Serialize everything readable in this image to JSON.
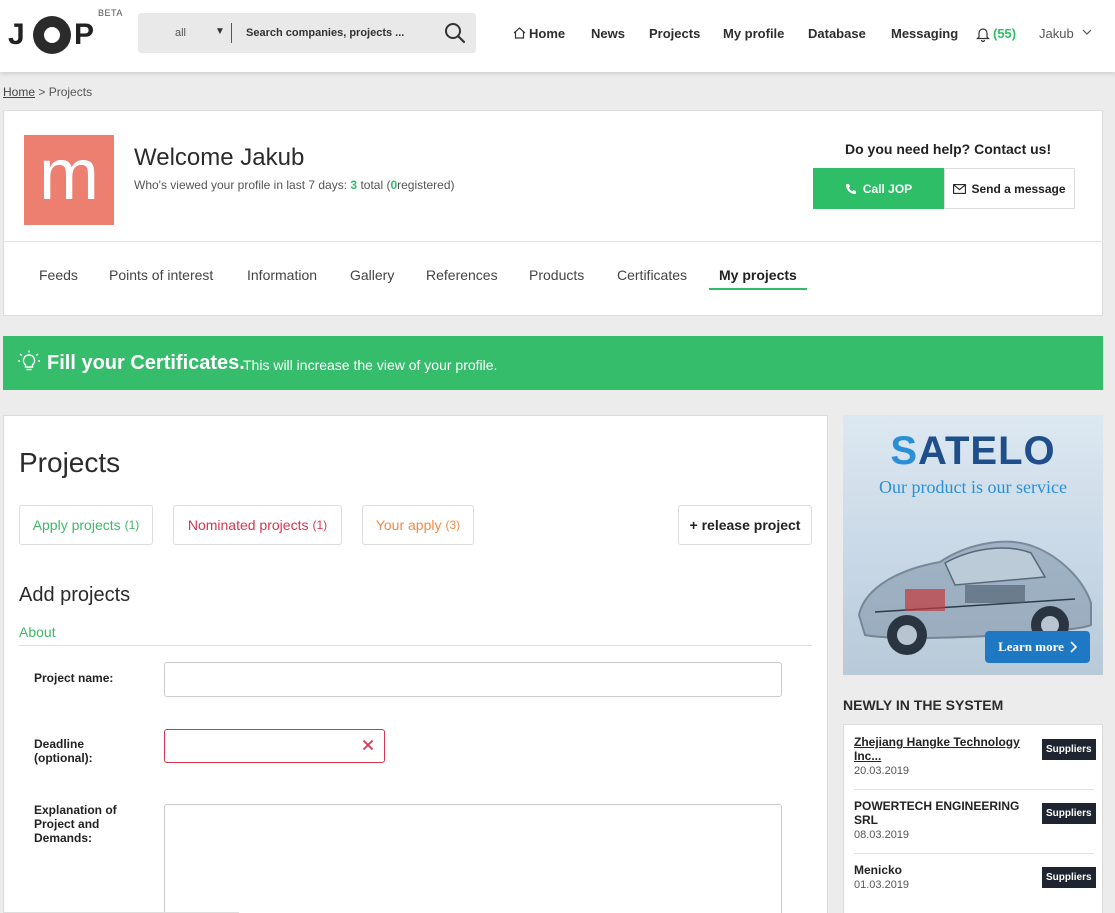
{
  "app": {
    "logo_text": "JOP",
    "beta_label": "BETA"
  },
  "search": {
    "scope_value": "all",
    "placeholder": "Search companies, projects ..."
  },
  "nav": {
    "home": "Home",
    "news": "News",
    "projects": "Projects",
    "my_profile": "My profile",
    "database": "Database",
    "messaging": "Messaging",
    "notifications_count": "(55)",
    "user_name": "Jakub"
  },
  "breadcrumb": {
    "home": "Home",
    "separator": ">",
    "current": "Projects"
  },
  "profile": {
    "avatar_letter": "m",
    "avatar_color": "#ec7f6f",
    "welcome": "Welcome Jakub",
    "viewed_prefix": "Who's viewed your profile in last 7 days:",
    "viewed_total": "3",
    "viewed_total_label": "total (",
    "viewed_registered": "0",
    "viewed_registered_label": "registered)",
    "help_text": "Do you need help? Contact us!",
    "call_button": "Call JOP",
    "message_button": "Send a message"
  },
  "tabs": [
    {
      "label": "Feeds"
    },
    {
      "label": "Points of interest"
    },
    {
      "label": "Information"
    },
    {
      "label": "Gallery"
    },
    {
      "label": "References"
    },
    {
      "label": "Products"
    },
    {
      "label": "Certificates"
    },
    {
      "label": "My projects",
      "active": true
    }
  ],
  "banner": {
    "strong": "Fill your Certificates.",
    "rest": "This will increase the view of your profile.",
    "color": "#36bd6c"
  },
  "projects": {
    "title": "Projects",
    "filters": {
      "apply_label": "Apply projects",
      "apply_count": "(1)",
      "nominated_label": "Nominated projects",
      "nominated_count": "(1)",
      "your_apply_label": "Your apply",
      "your_apply_count": "(3)"
    },
    "release_button": "+ release project",
    "add_title": "Add projects",
    "section_about": "About",
    "form": {
      "project_name_label": "Project name:",
      "project_name_value": "",
      "deadline_label_1": "Deadline",
      "deadline_label_2": "(optional):",
      "deadline_value": "",
      "explanation_label_1": "Explanation of",
      "explanation_label_2": "Project and",
      "explanation_label_3": "Demands:",
      "explanation_value": ""
    }
  },
  "ad": {
    "brand_s": "S",
    "brand_rest": "ATELO",
    "tagline": "Our product is our service",
    "learn_more": "Learn more"
  },
  "newly": {
    "title": "NEWLY IN THE SYSTEM",
    "items": [
      {
        "name": "Zhejiang Hangke Technology Inc...",
        "date": "20.03.2019",
        "badge": "Suppliers"
      },
      {
        "name": "POWERTECH ENGINEERING SRL",
        "date": "08.03.2019",
        "badge": "Suppliers"
      },
      {
        "name": "Menicko",
        "date": "01.03.2019",
        "badge": "Suppliers"
      }
    ]
  },
  "colors": {
    "accent_green": "#2fbe68",
    "nominated_red": "#d93550",
    "your_apply_orange": "#ee8a47"
  }
}
